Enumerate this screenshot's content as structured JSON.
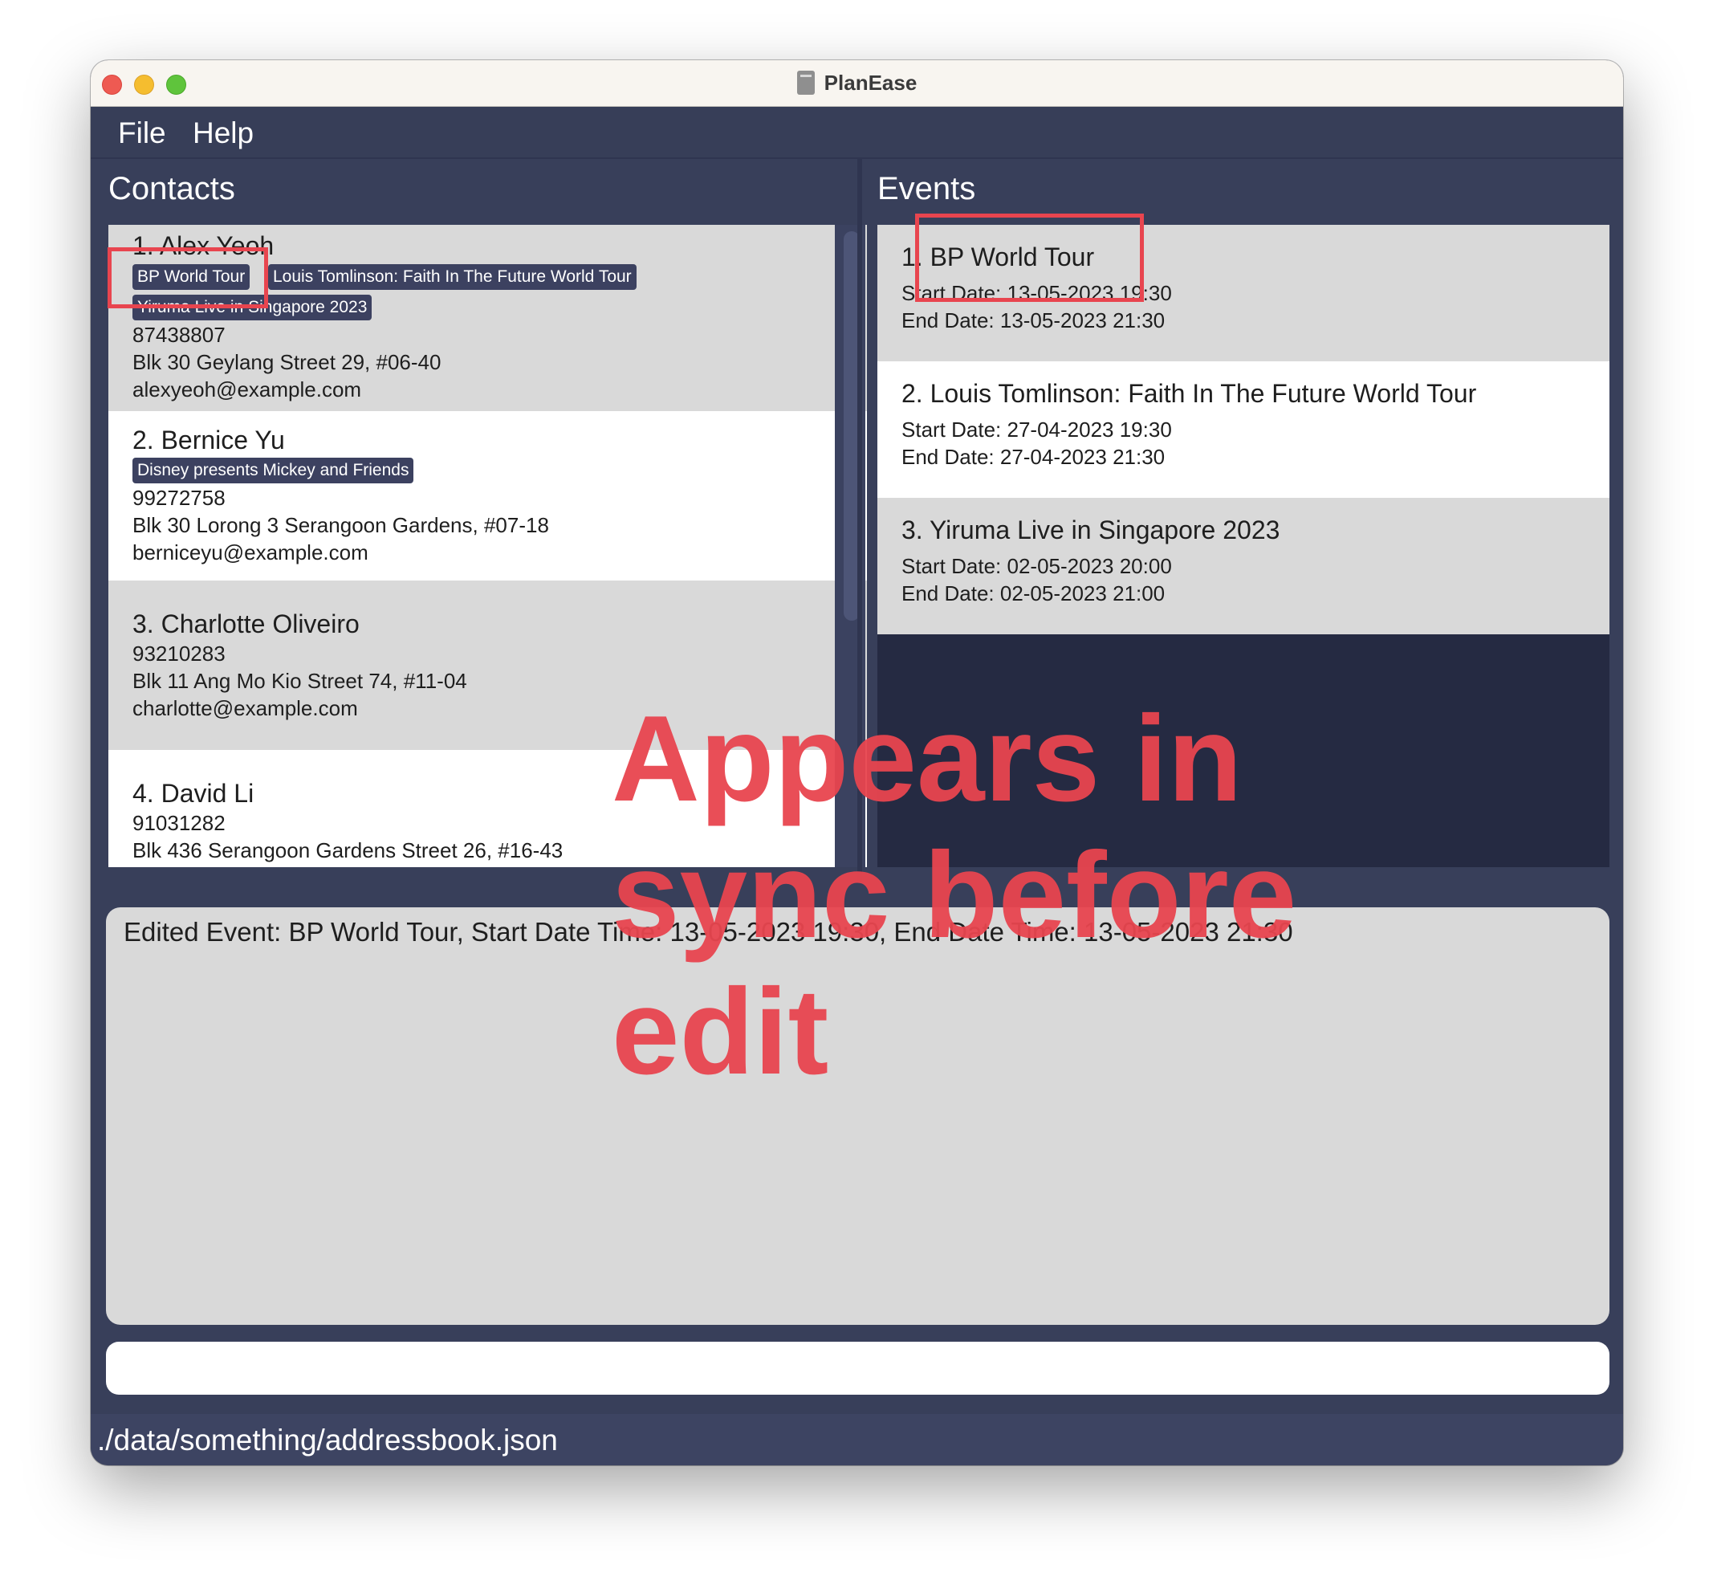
{
  "window": {
    "title": "PlanEase"
  },
  "menu": [
    "File",
    "Help"
  ],
  "contacts": {
    "title": "Contacts",
    "items": [
      {
        "name": "1.  Alex Yeoh",
        "tags": [
          "BP World Tour",
          "Louis Tomlinson: Faith In The Future World Tour",
          "Yiruma Live in Singapore 2023"
        ],
        "phone": "87438807",
        "address": "Blk 30 Geylang Street 29, #06-40",
        "email": "alexyeoh@example.com"
      },
      {
        "name": "2.  Bernice Yu",
        "tags": [
          "Disney presents Mickey and Friends"
        ],
        "phone": "99272758",
        "address": "Blk 30 Lorong 3 Serangoon Gardens, #07-18",
        "email": "berniceyu@example.com"
      },
      {
        "name": "3.  Charlotte Oliveiro",
        "phone": "93210283",
        "address": "Blk 11 Ang Mo Kio Street 74, #11-04",
        "email": "charlotte@example.com"
      },
      {
        "name": "4.  David Li",
        "phone": "91031282",
        "address": "Blk 436 Serangoon Gardens Street 26, #16-43"
      }
    ]
  },
  "events": {
    "title": "Events",
    "items": [
      {
        "name": "1.  BP World Tour",
        "start": "Start Date: 13-05-2023 19:30",
        "end": "End Date: 13-05-2023 21:30"
      },
      {
        "name": "2.  Louis Tomlinson: Faith In The Future World Tour",
        "start": "Start Date: 27-04-2023 19:30",
        "end": "End Date: 27-04-2023 21:30"
      },
      {
        "name": "3.  Yiruma Live in Singapore 2023",
        "start": "Start Date: 02-05-2023 20:00",
        "end": "End Date: 02-05-2023 21:00"
      }
    ]
  },
  "result": {
    "text": "Edited Event: BP World Tour, Start Date Time: 13-05-2023 19:30, End Date Time: 13-05-2023 21:30"
  },
  "command": {
    "value": ""
  },
  "status": {
    "path": "./data/something/addressbook.json"
  },
  "annotation": {
    "lines": [
      "Appears in",
      "sync before",
      "edit"
    ],
    "color": "#e8454f"
  }
}
